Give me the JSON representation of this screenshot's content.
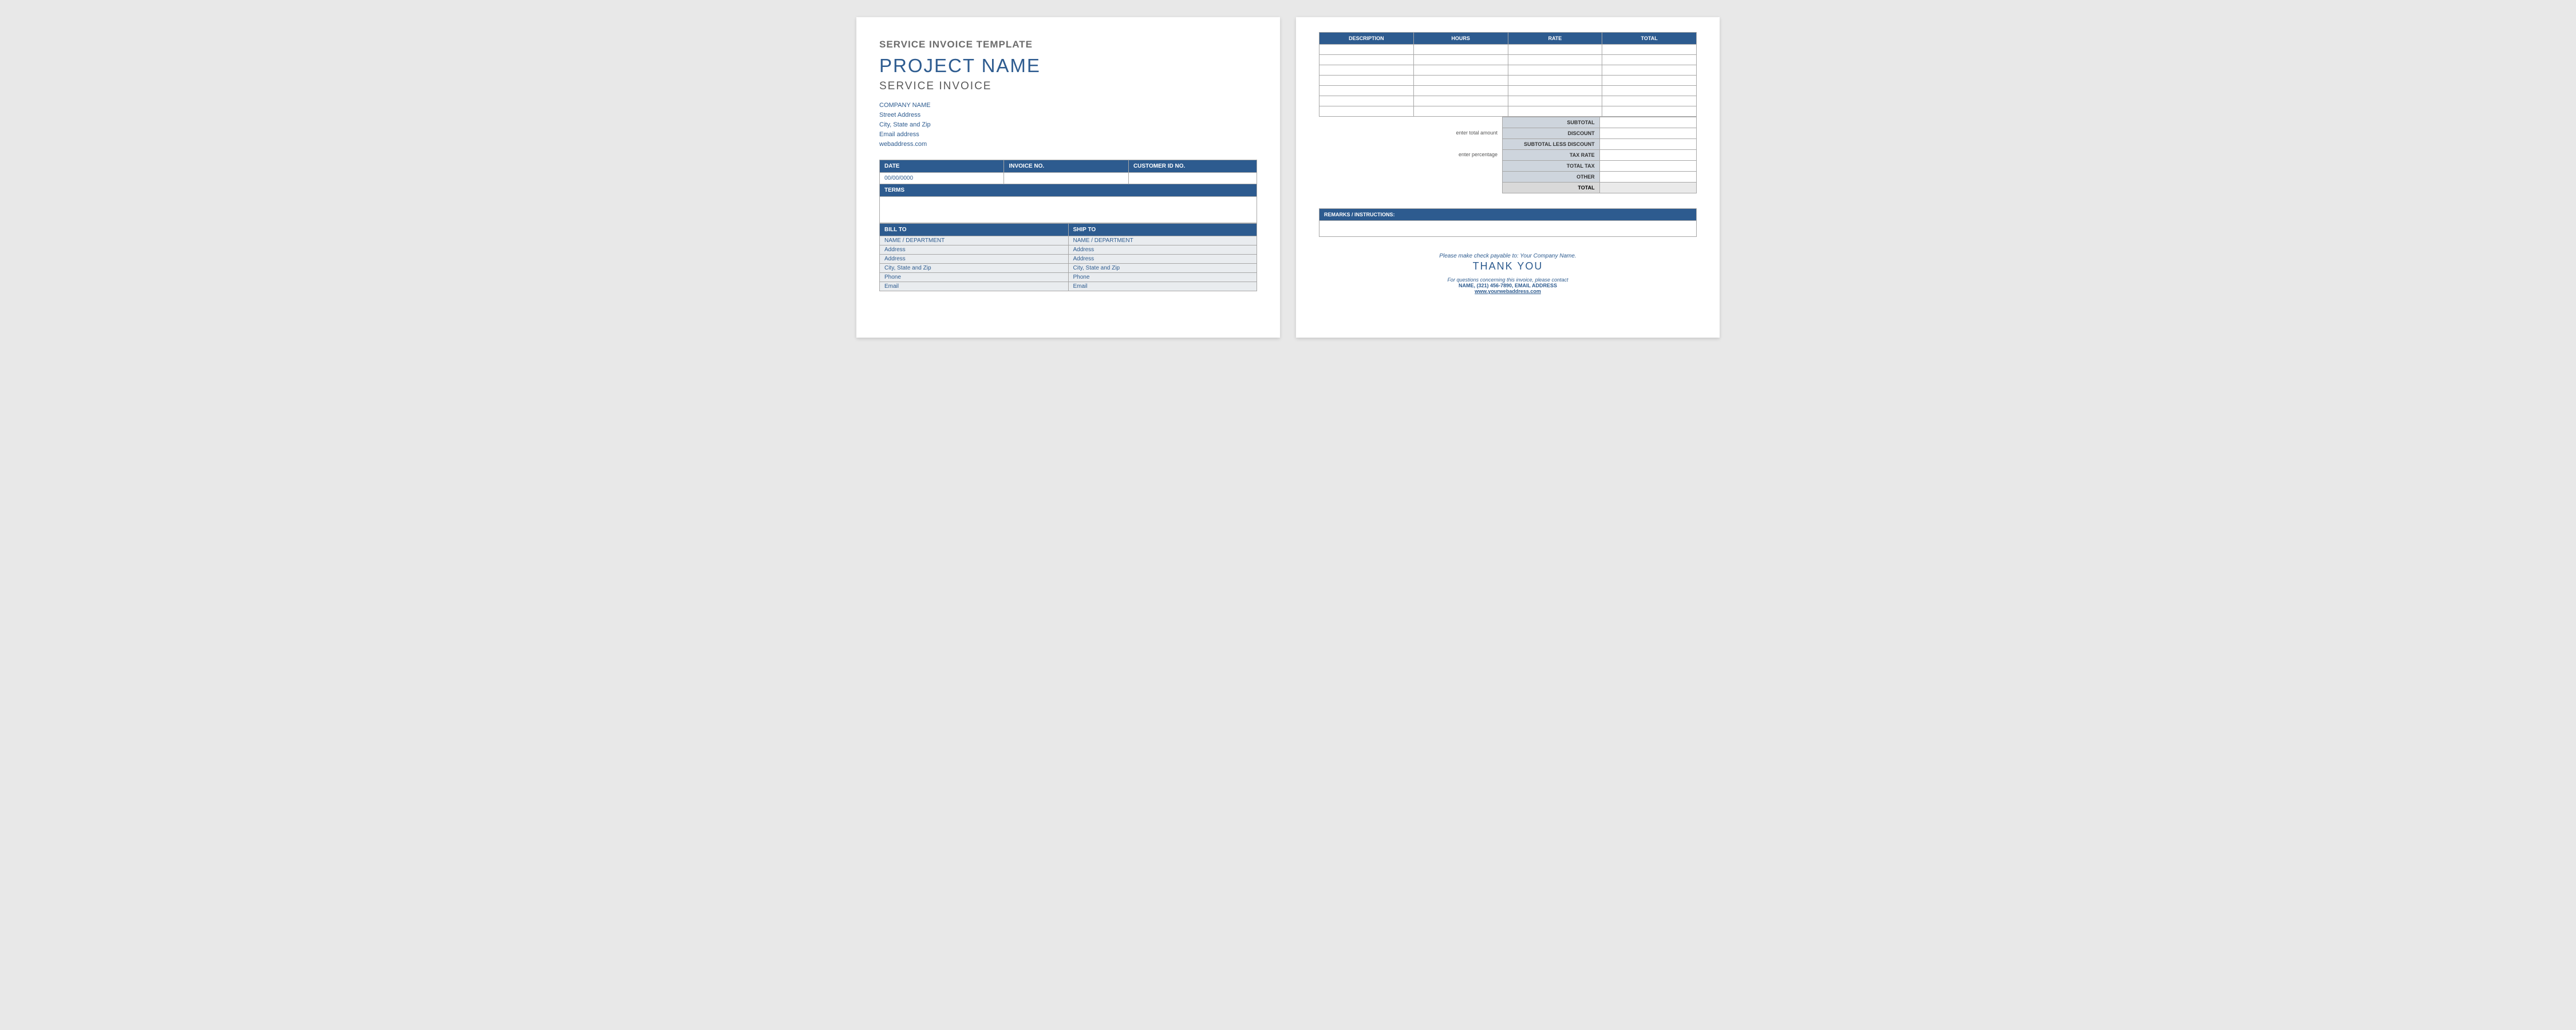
{
  "page1": {
    "templateTitle": "SERVICE INVOICE TEMPLATE",
    "projectName": "PROJECT NAME",
    "subheading": "SERVICE INVOICE",
    "company": {
      "name": "COMPANY NAME",
      "street": "Street Address",
      "cityStateZip": "City, State and Zip",
      "email": "Email address",
      "web": "webaddress.com"
    },
    "infoHeaders": {
      "date": "DATE",
      "invoiceNo": "INVOICE NO.",
      "customerId": "CUSTOMER ID NO."
    },
    "dateValue": "00/00/0000",
    "termsHeader": "TERMS",
    "partyHeaders": {
      "billTo": "BILL TO",
      "shipTo": "SHIP TO"
    },
    "partyFields": {
      "nameDept": "NAME / DEPARTMENT",
      "address1": "Address",
      "address2": "Address",
      "cityStateZip": "City, State and Zip",
      "phone": "Phone",
      "email": "Email"
    }
  },
  "page2": {
    "itemHeaders": {
      "description": "DESCRIPTION",
      "hours": "HOURS",
      "rate": "RATE",
      "total": "TOTAL"
    },
    "hints": {
      "enterTotal": "enter total amount",
      "enterPct": "enter percentage"
    },
    "summaryLabels": {
      "subtotal": "SUBTOTAL",
      "discount": "DISCOUNT",
      "subLessDiscount": "SUBTOTAL LESS DISCOUNT",
      "taxRate": "TAX RATE",
      "totalTax": "TOTAL TAX",
      "other": "OTHER",
      "total": "TOTAL"
    },
    "remarksHeader": "REMARKS / INSTRUCTIONS:",
    "footer": {
      "payable": "Please make check payable to: Your Company Name.",
      "thankyou": "THANK YOU",
      "questions": "For questions concerning this invoice, please contact",
      "contact": "NAME, (321) 456-7890, EMAIL ADDRESS",
      "web": "www.yourwebaddress.com"
    }
  }
}
